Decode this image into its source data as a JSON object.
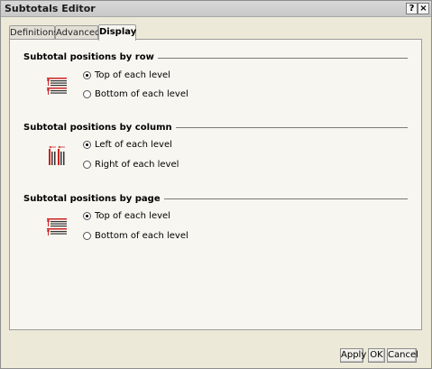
{
  "window": {
    "title": "Subtotals Editor",
    "help_label": "?",
    "close_label": "×"
  },
  "tabs": [
    {
      "label": "Definitions"
    },
    {
      "label": "Advanced"
    },
    {
      "label": "Display"
    }
  ],
  "sections": [
    {
      "title": "Subtotal positions by row",
      "options": [
        "Top of each level",
        "Bottom of each level"
      ],
      "selected": 0,
      "icon": "row-subtotal-icon"
    },
    {
      "title": "Subtotal positions by column",
      "options": [
        "Left of each level",
        "Right of each level"
      ],
      "selected": 0,
      "icon": "column-subtotal-icon"
    },
    {
      "title": "Subtotal positions by page",
      "options": [
        "Top of each level",
        "Bottom of each level"
      ],
      "selected": 0,
      "icon": "page-subtotal-icon"
    }
  ],
  "footer": {
    "apply_label": "Apply",
    "ok_label": "OK",
    "cancel_label": "Cancel"
  },
  "colors": {
    "icon_red": "#cc2222",
    "icon_dark": "#333333"
  }
}
